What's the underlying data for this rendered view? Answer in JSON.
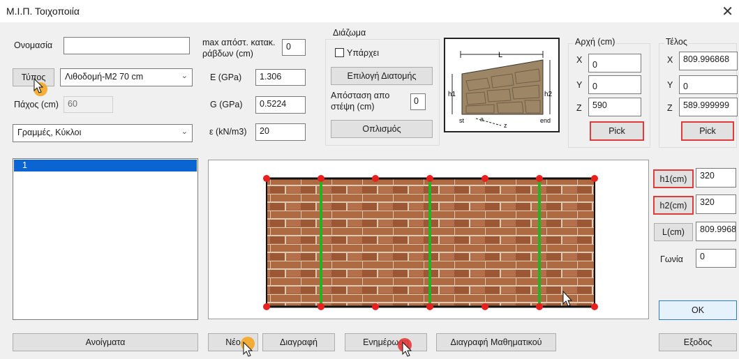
{
  "window": {
    "title": "Μ.Ι.Π. Τοιχοποιία",
    "close_glyph": "✕"
  },
  "form": {
    "name_label": "Ονομασία",
    "name_value": "",
    "type_button": "Τύπος",
    "type_select": "Λιθοδομή-Μ2 70 cm",
    "thickness_label": "Πάχος (cm)",
    "thickness_value": "60",
    "draw_select": "Γραμμές, Κύκλοι",
    "max_spacing_label_1": "max απόστ. κατακ.",
    "max_spacing_label_2": "ράβδων (cm)",
    "max_spacing_value": "0",
    "E_label": "E (GPa)",
    "E_value": "1.306",
    "G_label": "G (GPa)",
    "G_value": "0.5224",
    "eps_label": "ε (kN/m3)",
    "eps_value": "20"
  },
  "diaphragm": {
    "group_label": "Διάζωμα",
    "exists_label": "Υπάρχει",
    "select_section_button": "Επιλογή Διατομής",
    "distance_label_1": "Απόσταση απο",
    "distance_label_2": "στέψη (cm)",
    "distance_value": "0",
    "reinforcement_button": "Οπλισμός"
  },
  "diagram": {
    "L": "L",
    "h1": "h1",
    "h2": "h2",
    "st": "st",
    "end": "end",
    "z": "z",
    "a": "a"
  },
  "start": {
    "group_label": "Αρχή (cm)",
    "x_label": "X",
    "x_value": "0",
    "y_label": "Y",
    "y_value": "0",
    "z_label": "Z",
    "z_value": "590",
    "pick": "Pick"
  },
  "end": {
    "group_label": "Τέλος",
    "x_label": "X",
    "x_value": "809.996868",
    "y_label": "Y",
    "y_value": "0",
    "z_label": "Z",
    "z_value": "589.999999",
    "pick": "Pick"
  },
  "list": {
    "items": [
      "1"
    ]
  },
  "side": {
    "h1_button": "h1(cm)",
    "h1_value": "320",
    "h2_button": "h2(cm)",
    "h2_value": "320",
    "L_button": "L(cm)",
    "L_value": "809.9968",
    "angle_label": "Γωνία",
    "angle_value": "0",
    "ok": "OK"
  },
  "bottom": {
    "openings": "Ανοίγματα",
    "new": "Νέο",
    "delete": "Διαγραφή",
    "update": "Ενημέρωση",
    "delete_math": "Διαγραφή Μαθηματικού",
    "exit": "Εξοδος"
  },
  "colors": {
    "pick_border": "#e03b3b",
    "selection": "#0a64d2",
    "beam_green": "#22b322",
    "node_red": "#e82020",
    "brick": "#a8613a"
  }
}
